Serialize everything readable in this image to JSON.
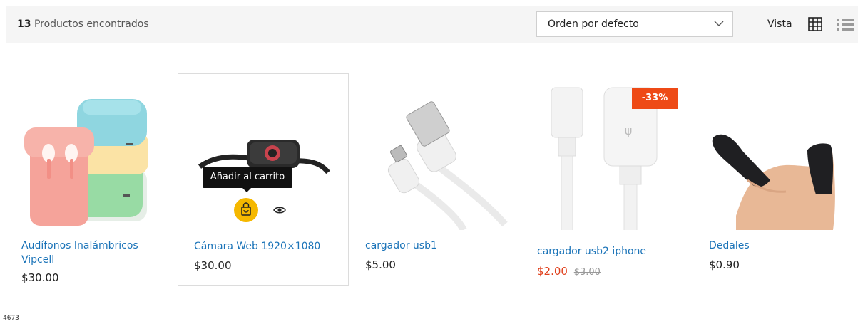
{
  "results": {
    "count": "13",
    "label": "Productos encontrados"
  },
  "sort": {
    "selected": "Orden por defecto"
  },
  "view": {
    "label": "Vista"
  },
  "products": [
    {
      "title": "Audífonos Inalámbricos Vipcell",
      "price": "$30.00"
    },
    {
      "title": "Cámara Web 1920×1080",
      "price": "$30.00",
      "tooltip": "Añadir al carrito"
    },
    {
      "title": "cargador usb1",
      "price": "$5.00"
    },
    {
      "title": "cargador usb2 iphone",
      "sale_price": "$2.00",
      "old_price": "$3.00",
      "badge": "-33%"
    },
    {
      "title": "Dedales",
      "price": "$0.90"
    }
  ],
  "footer": {
    "number": "4673"
  },
  "colors": {
    "link": "#1a73b8",
    "sale": "#e0401c",
    "badge": "#ee4a16",
    "cart_button": "#f5b800",
    "toolbar_bg": "#f5f5f5"
  }
}
